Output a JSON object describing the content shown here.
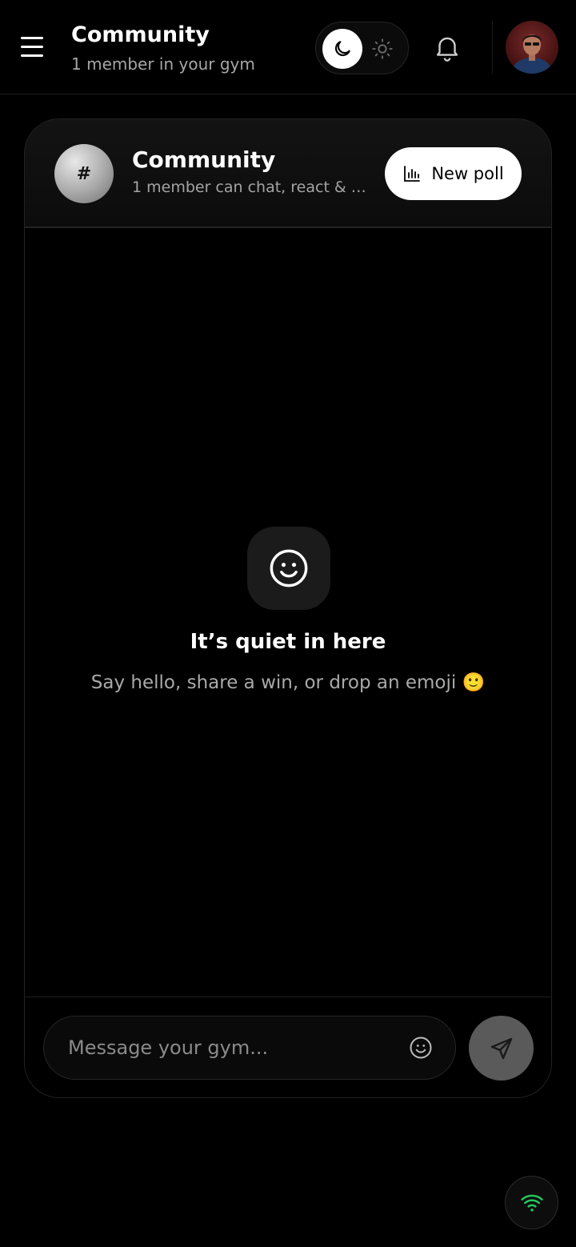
{
  "header": {
    "title": "Community",
    "subtitle": "1 member in your gym",
    "theme_mode": "dark",
    "icons": [
      "menu-icon",
      "moon-icon",
      "sun-icon",
      "bell-icon",
      "avatar"
    ]
  },
  "card": {
    "channel_symbol": "#",
    "title": "Community",
    "subtitle": "1 member can chat, react & v...",
    "new_poll_label": "New poll"
  },
  "empty_state": {
    "title": "It’s quiet in here",
    "subtitle": "Say hello, share a win, or drop an emoji 🙂"
  },
  "composer": {
    "placeholder": "Message your gym...",
    "value": ""
  },
  "status": {
    "connection_icon": "wifi-icon",
    "connection_color": "#22c55e"
  },
  "colors": {
    "background": "#000000",
    "accent": "#ffffff",
    "send_button": "#5a5a5a"
  }
}
